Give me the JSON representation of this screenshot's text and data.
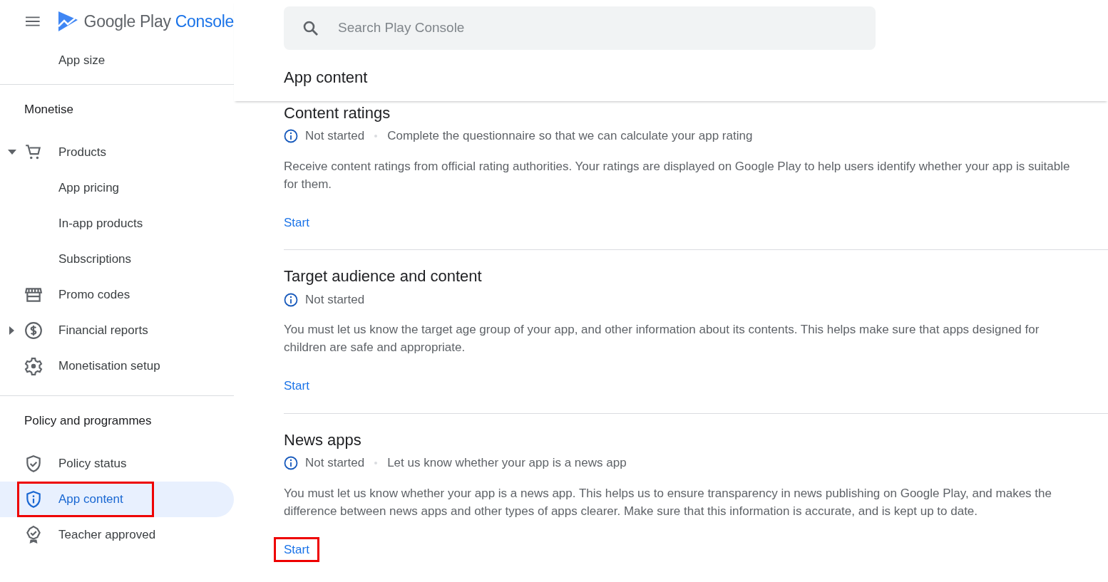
{
  "header": {
    "brand_main": "Google Play",
    "brand_accent": "Console"
  },
  "search": {
    "placeholder": "Search Play Console"
  },
  "page_title": "App content",
  "sidebar": {
    "sections": [
      {
        "items": [
          {
            "label": "App size",
            "kind": "sub",
            "selected": false
          }
        ]
      },
      {
        "heading": "Monetise",
        "items": [
          {
            "label": "Products",
            "kind": "icon",
            "expanded": true,
            "selected": false
          },
          {
            "label": "App pricing",
            "kind": "sub",
            "selected": false
          },
          {
            "label": "In-app products",
            "kind": "sub",
            "selected": false
          },
          {
            "label": "Subscriptions",
            "kind": "sub",
            "selected": false
          },
          {
            "label": "Promo codes",
            "kind": "icon",
            "selected": false
          },
          {
            "label": "Financial reports",
            "kind": "icon",
            "expanded": false,
            "selected": false
          },
          {
            "label": "Monetisation setup",
            "kind": "icon",
            "selected": false
          }
        ]
      },
      {
        "heading": "Policy and programmes",
        "items": [
          {
            "label": "Policy status",
            "kind": "icon",
            "selected": false
          },
          {
            "label": "App content",
            "kind": "icon",
            "selected": true,
            "highlighted": true
          },
          {
            "label": "Teacher approved",
            "kind": "icon",
            "selected": false
          }
        ]
      }
    ]
  },
  "sections": [
    {
      "title": "Content ratings",
      "status": "Not started",
      "note": "Complete the questionnaire so that we can calculate your app rating",
      "description": "Receive content ratings from official rating authorities. Your ratings are displayed on Google Play to help users identify whether your app is suitable for them.",
      "action": "Start",
      "highlighted": false
    },
    {
      "title": "Target audience and content",
      "status": "Not started",
      "description": "You must let us know the target age group of your app, and other information about its contents. This helps make sure that apps designed for children are safe and appropriate.",
      "action": "Start",
      "highlighted": false
    },
    {
      "title": "News apps",
      "status": "Not started",
      "note": "Let us know whether your app is a news app",
      "description": "You must let us know whether your app is a news app. This helps us to ensure transparency in news publishing on Google Play, and makes the difference between news apps and other types of apps clearer. Make sure that this information is accurate, and is kept up to date.",
      "action": "Start",
      "highlighted": true
    }
  ]
}
